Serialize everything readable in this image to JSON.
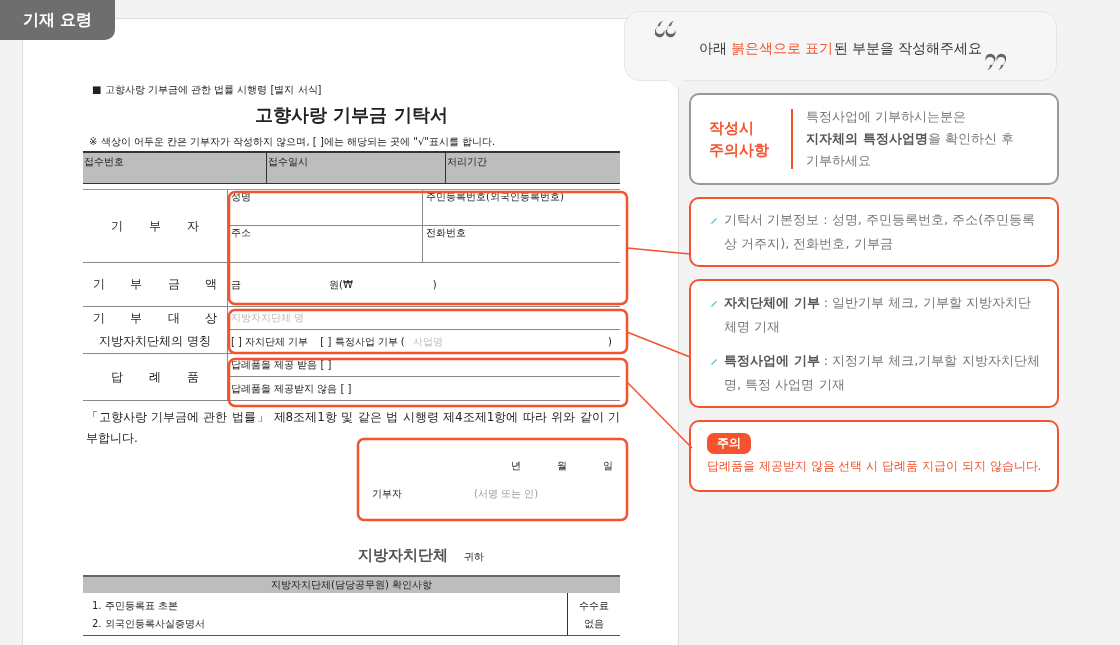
{
  "tag": "기재 요령",
  "form": {
    "legal_basis": "■ 고향사랑 기부금에 관한 법률 시행령 [별지 서식]",
    "title": "고향사랑 기부금 기탁서",
    "note": "※ 색상이 어두운 칸은 기부자가 작성하지 않으며, [  ]에는 해당되는 곳에 \"√\"표시를 합니다.",
    "office_fields": [
      "접수번호",
      "접수일시",
      "처리기간"
    ],
    "donor": {
      "label": "기 부 자",
      "fields": [
        "성명",
        "주민등록번호(외국인등록번호)",
        "주소",
        "전화번호"
      ]
    },
    "amount": {
      "label": "기 부 금 액",
      "prefix": "금",
      "unit": "원(₩",
      "close": ")"
    },
    "target": {
      "label_lines": [
        "기 부 대 상",
        "지방자치단체의 명칭"
      ],
      "placeholder": "지방자치단체 명",
      "option_1": "[ ] 자치단체 기부",
      "option_2": "[ ] 특정사업 기부 (",
      "project_placeholder": "사업명",
      "close": ")"
    },
    "gift": {
      "label": "답 례 품",
      "options": [
        "답례품을 제공 받음 [  ]",
        "답례품을 제공받지 않음 [  ]"
      ]
    },
    "statement": "「고향사랑 기부금에 관한 법률」 제8조제1항 및 같은 법 시행령 제4조제1항에 따라 위와 같이 기부합니다.",
    "date_units": [
      "년",
      "월",
      "일"
    ],
    "signer": "기부자",
    "sign_hint": "(서명 또는 인)",
    "addressee": "지방자치단체",
    "addressee_suffix": "귀하",
    "check": {
      "title": "지방자치단체(담당공무원) 확인사항",
      "items": [
        "1. 주민등록표 초본",
        "2. 외국인등록사실증명서"
      ],
      "fee_label": "수수료",
      "fee": "없음"
    }
  },
  "guide": {
    "bubble": [
      {
        "text": "아래 ",
        "kind": "plain"
      },
      {
        "text": "붉은색으로 표기",
        "kind": "highlight"
      },
      {
        "text": "된 부분을 작성해주세요",
        "kind": "plain"
      }
    ],
    "caution": {
      "title_lines": [
        "작성시",
        "주의사항"
      ],
      "lines": [
        "특정사업에 기부하시는분은",
        "**지자체의 특정사업명**을 확인하신 후",
        "기부하세요"
      ]
    },
    "cards": [
      {
        "items": [
          "기탁서 기본정보 : 성명, 주민등록번호, 주소(주민등록상 거주지), 전화번호, 기부금"
        ]
      },
      {
        "items": [
          "**자치단체에 기부** : 일반기부 체크, 기부할 지방자치단체명 기재",
          "**특정사업에 기부** : 지정기부 체크,기부할 지방자치단체명, 특정 사업명 기재"
        ]
      }
    ],
    "warning": {
      "badge": "주의",
      "text": "답례품을 제공받지 않음 선택 시 답례품 지급이 되지 않습니다."
    }
  }
}
